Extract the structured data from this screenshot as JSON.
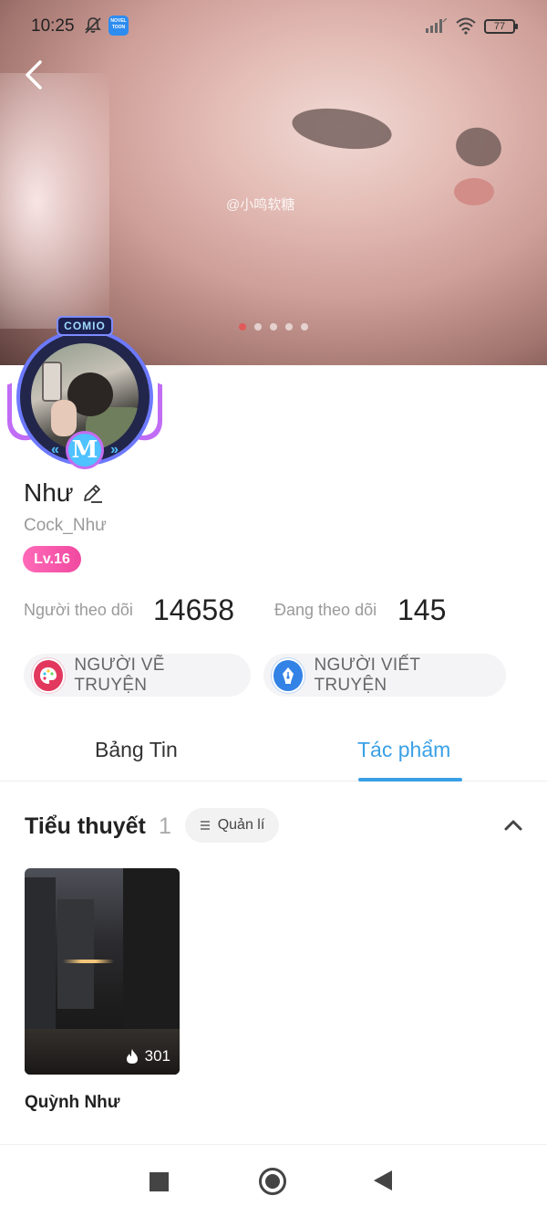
{
  "status_bar": {
    "time": "10:25",
    "app_icon_text": "NOVEL TOON",
    "battery": "77"
  },
  "banner": {
    "watermark": "@小鸣软糖",
    "carousel_pages": 5,
    "active_page": 1
  },
  "avatar": {
    "frame_badge": "COMIO",
    "frame_emblem": "M"
  },
  "profile": {
    "name": "Như",
    "username": "Cock_Như",
    "level": "Lv.16"
  },
  "stats": {
    "followers_label": "Người theo dõi",
    "followers_value": "14658",
    "following_label": "Đang theo dõi",
    "following_value": "145"
  },
  "roles": [
    {
      "label": "NGƯỜI VẼ TRUYỆN",
      "icon": "palette-icon"
    },
    {
      "label": "NGƯỜI VIẾT TRUYỆN",
      "icon": "pen-nib-icon"
    }
  ],
  "tabs": {
    "feed": "Bảng Tin",
    "works": "Tác phẩm",
    "active": "works"
  },
  "section": {
    "title": "Tiểu thuyết",
    "count": "1",
    "manage_label": "Quản lí"
  },
  "books": [
    {
      "title": "Quỳnh Như",
      "views": "301"
    }
  ],
  "colors": {
    "accent": "#3aa0e6",
    "level_badge": "#f049a0",
    "artist_icon": "#e2385e",
    "writer_icon": "#3383e6"
  }
}
